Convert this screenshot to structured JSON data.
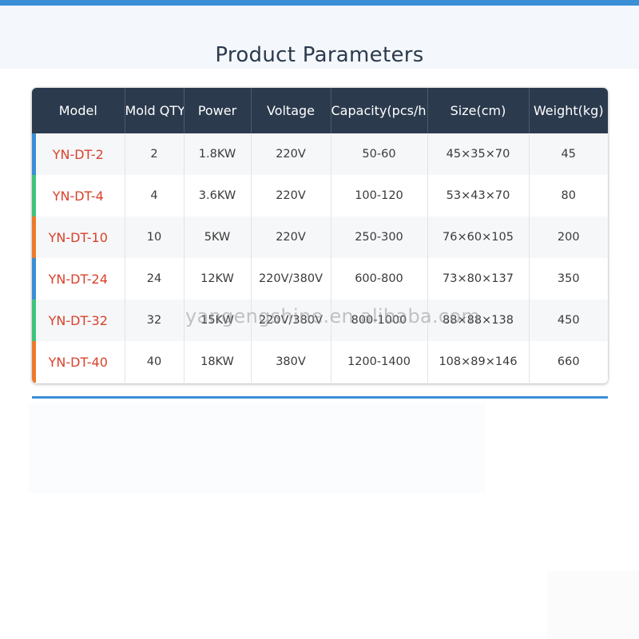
{
  "page": {
    "title": "Product Parameters",
    "watermark": "yangengshine.en.alibaba.com",
    "accent_color": "#3a8fd6",
    "header_color": "#2b3a4d",
    "model_text_color": "#d9412b"
  },
  "table": {
    "headers": [
      "Model",
      "Mold QTY",
      "Power",
      "Voltage",
      "Capacity(pcs/h)",
      "Size(cm)",
      "Weight(kg)"
    ],
    "rows": [
      {
        "accent": "#3a8fd6",
        "cells": [
          "YN-DT-2",
          "2",
          "1.8KW",
          "220V",
          "50-60",
          "45×35×70",
          "45"
        ]
      },
      {
        "accent": "#3ec47a",
        "cells": [
          "YN-DT-4",
          "4",
          "3.6KW",
          "220V",
          "100-120",
          "53×43×70",
          "80"
        ]
      },
      {
        "accent": "#ec7a2c",
        "cells": [
          "YN-DT-10",
          "10",
          "5KW",
          "220V",
          "250-300",
          "76×60×105",
          "200"
        ]
      },
      {
        "accent": "#3a8fd6",
        "cells": [
          "YN-DT-24",
          "24",
          "12KW",
          "220V/380V",
          "600-800",
          "73×80×137",
          "350"
        ]
      },
      {
        "accent": "#3ec47a",
        "cells": [
          "YN-DT-32",
          "32",
          "15KW",
          "220V/380V",
          "800-1000",
          "88×88×138",
          "450"
        ]
      },
      {
        "accent": "#ec7a2c",
        "cells": [
          "YN-DT-40",
          "40",
          "18KW",
          "380V",
          "1200-1400",
          "108×89×146",
          "660"
        ]
      }
    ]
  }
}
